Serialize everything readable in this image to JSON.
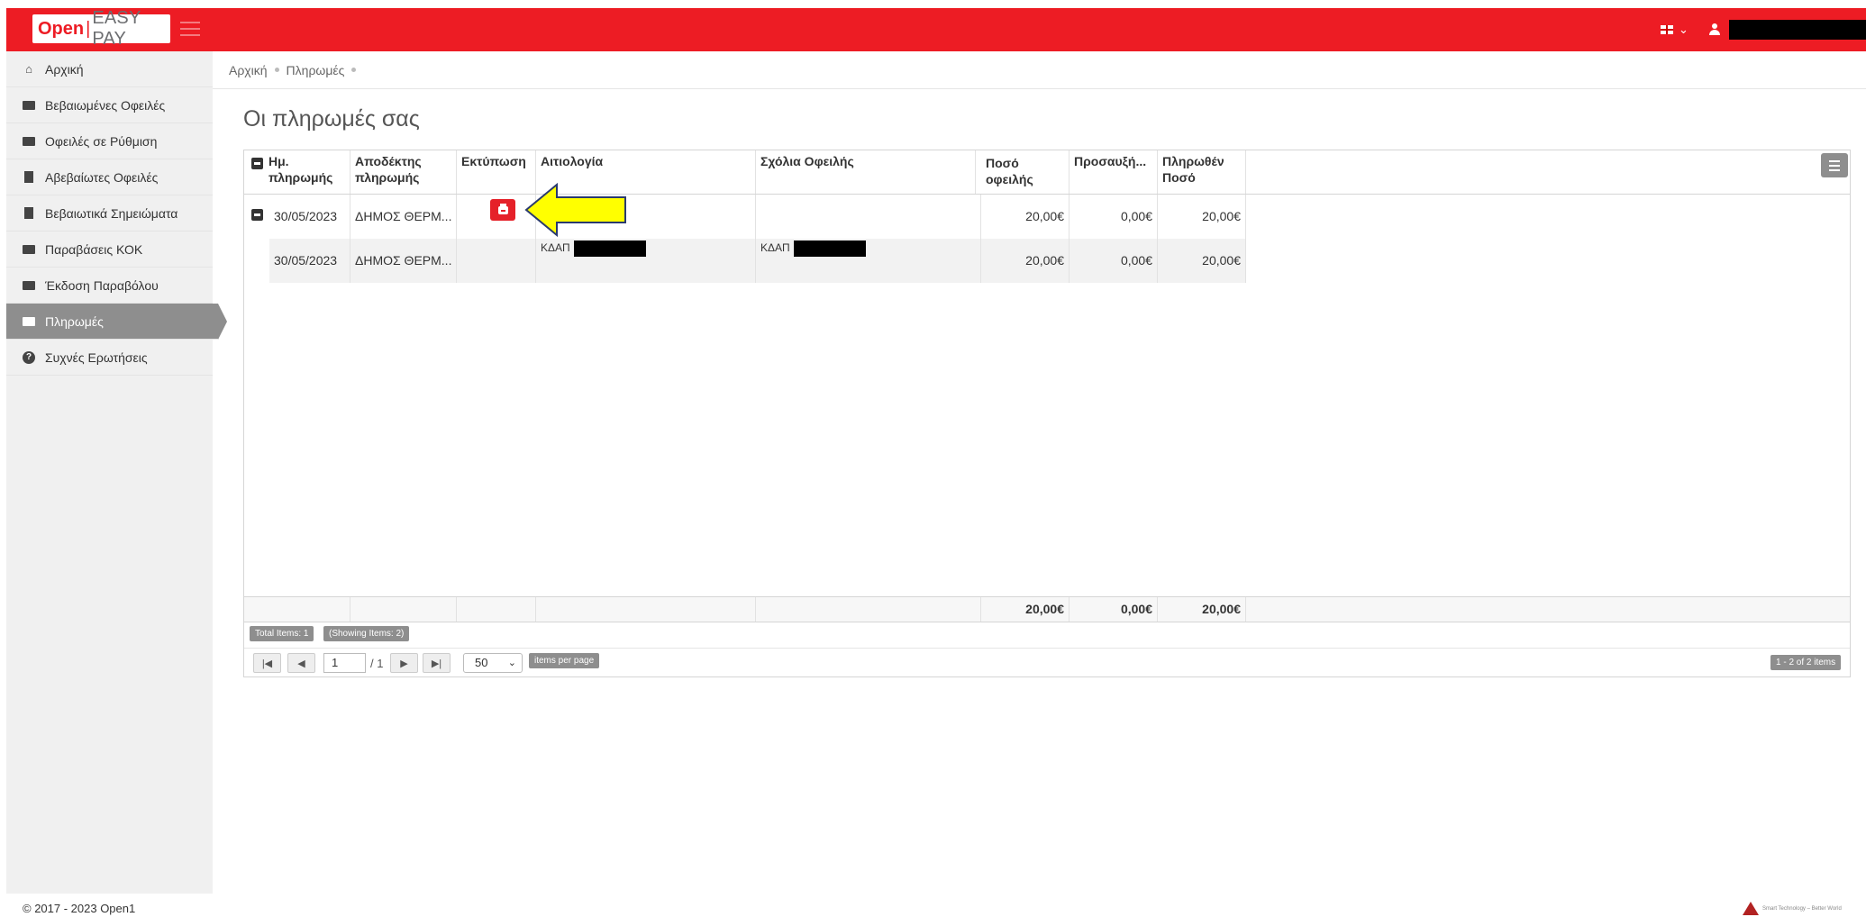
{
  "header": {
    "logo_open": "Open",
    "logo_sep": "|",
    "logo_easy": "EASY PAY",
    "lang_caret": "⌄",
    "user_caret": "⌄"
  },
  "sidebar": {
    "items": [
      {
        "label": "Αρχική",
        "icon": "home-icon"
      },
      {
        "label": "Βεβαιωμένες Οφειλές",
        "icon": "money-icon"
      },
      {
        "label": "Οφειλές σε Ρύθμιση",
        "icon": "handshake-icon"
      },
      {
        "label": "Αβεβαίωτες Οφειλές",
        "icon": "document-icon"
      },
      {
        "label": "Βεβαιωτικά Σημειώματα",
        "icon": "file-icon"
      },
      {
        "label": "Παραβάσεις ΚΟΚ",
        "icon": "ticket-icon"
      },
      {
        "label": "Έκδοση Παραβόλου",
        "icon": "ticket-icon"
      },
      {
        "label": "Πληρωμές",
        "icon": "credit-card-icon",
        "active": true
      },
      {
        "label": "Συχνές Ερωτήσεις",
        "icon": "question-icon"
      }
    ]
  },
  "breadcrumb": {
    "home": "Αρχική",
    "current": "Πληρωμές"
  },
  "page": {
    "title": "Οι πληρωμές σας"
  },
  "grid": {
    "columns": {
      "date": "Ημ. πληρωμής",
      "recipient": "Αποδέκτης πληρωμής",
      "print": "Εκτύπωση",
      "reason": "Αιτιολογία",
      "comments": "Σχόλια Οφειλής",
      "amount_due": "Ποσό οφειλής",
      "surcharge": "Προσαυξή...",
      "paid": "Πληρωθέν Ποσό"
    },
    "rows": [
      {
        "date": "30/05/2023",
        "recipient": "ΔΗΜΟΣ ΘΕΡΜ...",
        "reason": "",
        "comments": "",
        "amount_due": "20,00€",
        "surcharge": "0,00€",
        "paid": "20,00€"
      },
      {
        "date": "30/05/2023",
        "recipient": "ΔΗΜΟΣ ΘΕΡΜ...",
        "reason": "ΚΔΑΠ",
        "comments": "ΚΔΑΠ",
        "amount_due": "20,00€",
        "surcharge": "0,00€",
        "paid": "20,00€"
      }
    ],
    "totals": {
      "amount_due": "20,00€",
      "surcharge": "0,00€",
      "paid": "20,00€"
    },
    "total_items": "Total Items: 1",
    "showing_items": "(Showing Items: 2)",
    "pager": {
      "page": "1",
      "of": "/ 1",
      "page_size": "50",
      "items_per_page": "items per page",
      "range": "1 - 2 of 2 items"
    }
  },
  "footer": {
    "copyright": "© 2017 - 2023 Open1",
    "brand_tagline": "Smart Technology – Better World"
  },
  "colors": {
    "brand_red": "#ed1c24",
    "arrow_yellow": "#ffff00",
    "active_gray": "#8e8e8e"
  }
}
